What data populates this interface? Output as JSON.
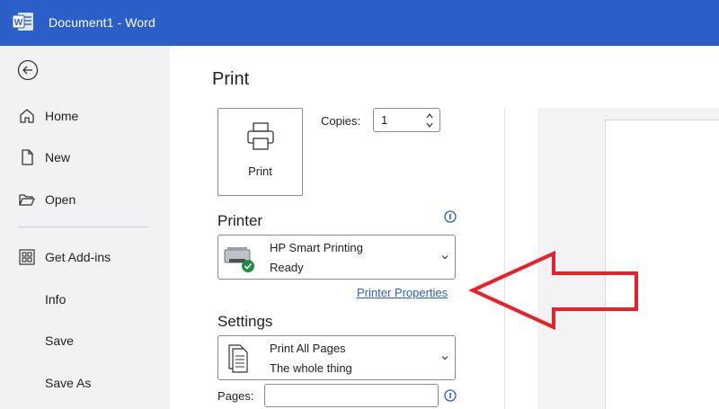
{
  "window": {
    "title": "Document1  -  Word"
  },
  "sidebar": {
    "back_icon": "back-arrow-icon",
    "items": [
      {
        "label": "Home",
        "icon": "home-icon"
      },
      {
        "label": "New",
        "icon": "new-document-icon"
      },
      {
        "label": "Open",
        "icon": "open-folder-icon"
      },
      {
        "label": "Get Add-ins",
        "icon": "add-ins-grid-icon"
      },
      {
        "label": "Info",
        "icon": ""
      },
      {
        "label": "Save",
        "icon": ""
      },
      {
        "label": "Save As",
        "icon": ""
      }
    ]
  },
  "print": {
    "title": "Print",
    "button_label": "Print",
    "copies_label": "Copies:",
    "copies_value": "1"
  },
  "printer": {
    "heading": "Printer",
    "name": "HP Smart Printing",
    "status": "Ready",
    "properties_link": "Printer Properties"
  },
  "settings": {
    "heading": "Settings",
    "pages_option": "Print All Pages",
    "pages_option_desc": "The whole thing",
    "pages_label": "Pages:",
    "pages_value": ""
  },
  "colors": {
    "titlebar": "#2b5fc7",
    "sidebar": "#f0f2f4",
    "link": "#2b5fc7",
    "annotation_arrow": "#e8202a",
    "ready_badge": "#1e8f3e"
  }
}
